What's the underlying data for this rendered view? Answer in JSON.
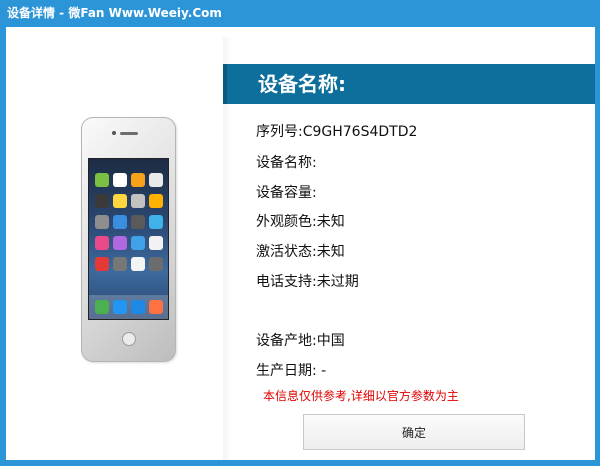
{
  "window": {
    "title": "设备详情 - 微Fan Www.Weeiy.Com"
  },
  "header": {
    "title": "设备名称:"
  },
  "info": {
    "serial": "序列号:C9GH76S4DTD2",
    "device_name": "设备名称:",
    "capacity": "设备容量:",
    "color": "外观颜色:未知",
    "activation": "激活状态:未知",
    "phone_support": "电话支持:未过期",
    "origin": "设备产地:中国",
    "manufacture_date": "生产日期:  -"
  },
  "notice": "本信息仅供参考,详细以官方参数为主",
  "buttons": {
    "ok_label": "确定"
  },
  "colors": {
    "titlebar": "#2c95d8",
    "header_band": "#0e6e9c",
    "notice_text": "#e00000"
  },
  "icons": {
    "device_image": "iphone-icon"
  }
}
